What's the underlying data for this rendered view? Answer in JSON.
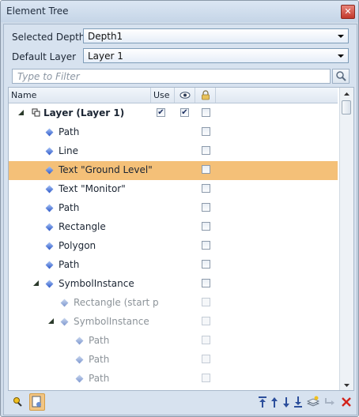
{
  "window": {
    "title": "Element Tree",
    "close_label": "✕"
  },
  "settings": {
    "selected_depth_label": "Selected Depth",
    "selected_depth_value": "Depth1",
    "default_layer_label": "Default Layer",
    "default_layer_value": "Layer 1"
  },
  "filter": {
    "placeholder": "Type to Filter"
  },
  "columns": {
    "name": "Name",
    "use": "Use"
  },
  "rows": [
    {
      "label": "Layer (Layer 1)",
      "use": true,
      "visible": true,
      "locked": false
    },
    {
      "label": "Path"
    },
    {
      "label": "Line"
    },
    {
      "label": "Text \"Ground Level\"",
      "selected": true
    },
    {
      "label": "Text \"Monitor\""
    },
    {
      "label": "Path"
    },
    {
      "label": "Rectangle"
    },
    {
      "label": "Polygon"
    },
    {
      "label": "Path"
    },
    {
      "label": "SymbolInstance"
    },
    {
      "label": "Rectangle (start p"
    },
    {
      "label": "SymbolInstance"
    },
    {
      "label": "Path"
    },
    {
      "label": "Path"
    },
    {
      "label": "Path"
    }
  ],
  "icons": {
    "expand": "expand-arrow-icon",
    "element": "element-diamond-icon",
    "layer": "layer-icon",
    "visibility": "eye-icon",
    "lock": "lock-icon",
    "filter": "magnifier-icon"
  },
  "colors": {
    "selection": "#f4c078",
    "accent": "#2d58c8"
  }
}
